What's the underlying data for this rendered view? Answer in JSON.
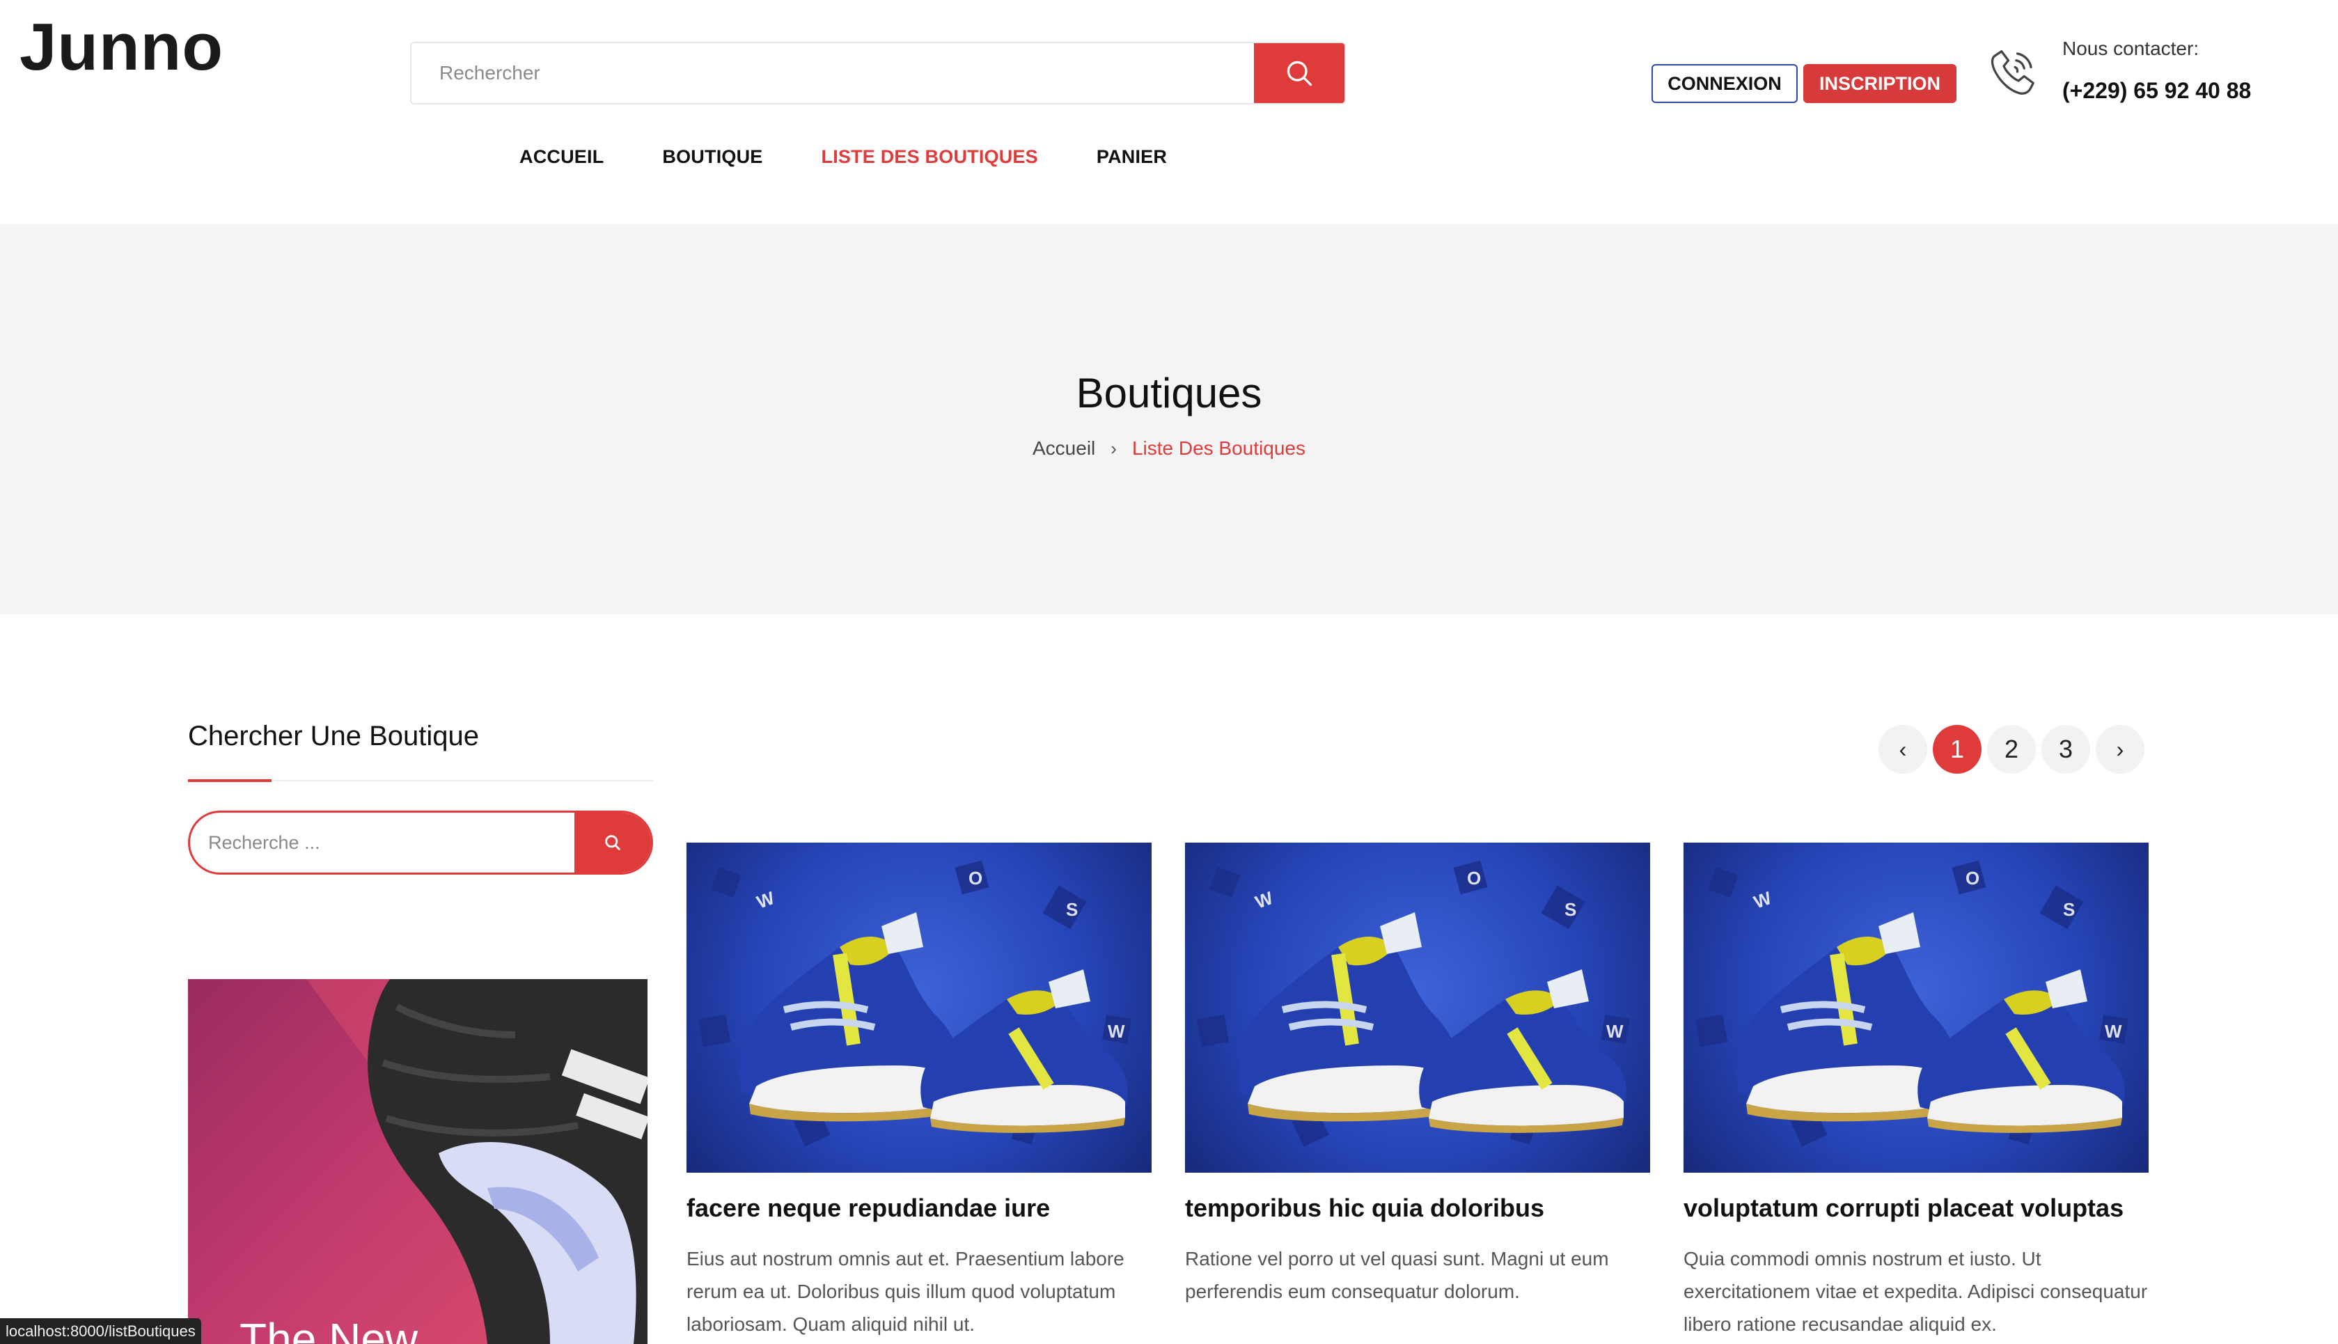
{
  "header": {
    "logo": "Junno",
    "search_placeholder": "Rechercher",
    "login_label": "CONNEXION",
    "signup_label": "INSCRIPTION",
    "contact_label": "Nous contacter:",
    "contact_phone": "(+229) 65 92 40 88"
  },
  "nav": {
    "items": [
      {
        "label": "ACCUEIL",
        "active": false
      },
      {
        "label": "BOUTIQUE",
        "active": false
      },
      {
        "label": "LISTE DES BOUTIQUES",
        "active": true
      },
      {
        "label": "PANIER",
        "active": false
      }
    ]
  },
  "banner": {
    "title": "Boutiques",
    "breadcrumb_home": "Accueil",
    "breadcrumb_current": "Liste Des Boutiques"
  },
  "sidebar": {
    "title": "Chercher Une Boutique",
    "search_placeholder": "Recherche ...",
    "promo_text": "The New"
  },
  "pagination": {
    "prev": "‹",
    "pages": [
      "1",
      "2",
      "3"
    ],
    "current": "1",
    "next": "›"
  },
  "shops": [
    {
      "title": "facere neque repudiandae iure",
      "description": "Eius aut nostrum omnis aut et. Praesentium labore rerum ea ut. Doloribus quis illum quod voluptatum laboriosam. Quam aliquid nihil ut."
    },
    {
      "title": "temporibus hic quia doloribus",
      "description": "Ratione vel porro ut vel quasi sunt. Magni ut eum perferendis eum consequatur dolorum."
    },
    {
      "title": "voluptatum corrupti placeat voluptas",
      "description": "Quia commodi omnis nostrum et iusto. Ut exercitationem vitae et expedita. Adipisci consequatur libero ratione recusandae aliquid ex."
    }
  ],
  "status_bar": {
    "url": "localhost:8000/listBoutiques"
  },
  "colors": {
    "accent": "#e03b3b",
    "login_border": "#2c4aa0",
    "banner_bg": "#f4f4f4"
  }
}
